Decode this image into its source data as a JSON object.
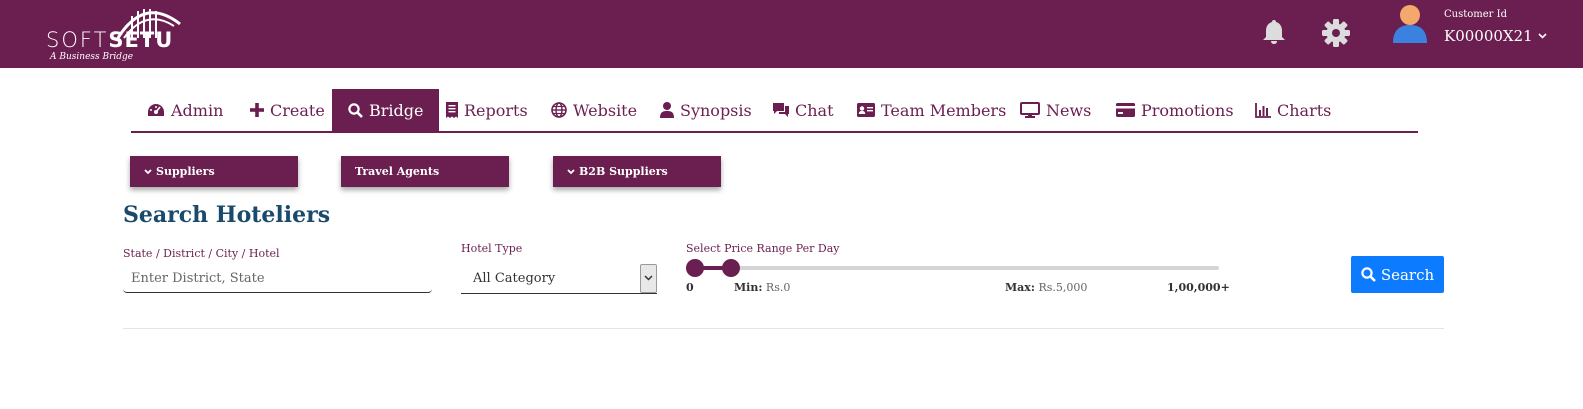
{
  "brand": {
    "name_part1": "SOFT",
    "name_part2": "SETU",
    "tagline": "A Business Bridge"
  },
  "header": {
    "customer_label": "Customer Id",
    "customer_id": "K00000X21",
    "icons": [
      "bell-icon",
      "gear-icon",
      "user-avatar-icon",
      "chevron-down-icon"
    ]
  },
  "nav": {
    "tabs": [
      {
        "label": "Admin",
        "icon": "dashboard-icon"
      },
      {
        "label": "Create",
        "icon": "plus-icon"
      },
      {
        "label": "Bridge",
        "icon": "search-icon",
        "active": true
      },
      {
        "label": "Reports",
        "icon": "receipt-icon"
      },
      {
        "label": "Website",
        "icon": "globe-icon"
      },
      {
        "label": "Synopsis",
        "icon": "user-icon"
      },
      {
        "label": "Chat",
        "icon": "chat-icon"
      },
      {
        "label": "Team Members",
        "icon": "id-card-icon"
      },
      {
        "label": "News",
        "icon": "monitor-icon"
      },
      {
        "label": "Promotions",
        "icon": "credit-card-icon"
      },
      {
        "label": "Charts",
        "icon": "bar-chart-icon"
      }
    ]
  },
  "sub_buttons": [
    {
      "label": "Suppliers",
      "has_chevron": true
    },
    {
      "label": "Travel Agents",
      "has_chevron": false
    },
    {
      "label": "B2B Suppliers",
      "has_chevron": true
    }
  ],
  "search": {
    "title": "Search Hoteliers",
    "location_label": "State / District / City / Hotel",
    "location_placeholder": "Enter District, State",
    "location_value": "",
    "hotel_type_label": "Hotel Type",
    "hotel_type_value": "All Category",
    "price_label": "Select Price Range Per Day",
    "price_scale_min": "0",
    "price_scale_max": "1,00,000+",
    "min_label": "Min:",
    "min_value": "Rs.0",
    "max_label": "Max:",
    "max_value": "Rs.5,000",
    "range_min_fraction": 0.0,
    "range_max_fraction": 0.05,
    "button_label": "Search"
  },
  "colors": {
    "brand": "#6b1f50",
    "title": "#1a4a6b",
    "search_button": "#0d7bff"
  }
}
